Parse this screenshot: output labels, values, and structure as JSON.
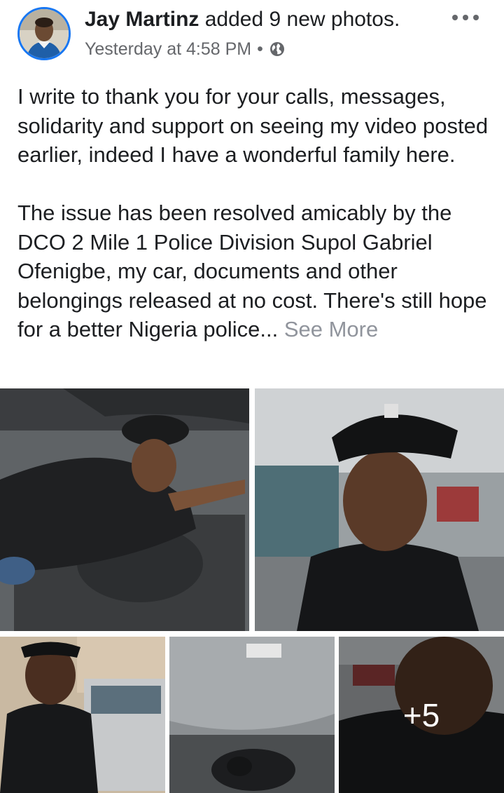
{
  "post": {
    "author_name": "Jay Martinz",
    "action": "added 9 new photos.",
    "timestamp": "Yesterday at 4:58 PM",
    "separator": "•",
    "privacy_icon": "globe-icon",
    "more_icon": "more-horizontal-icon",
    "body_paragraph_1": "I write to thank you for your calls, messages, solidarity and support on seeing my video posted earlier, indeed I have a wonderful family here.",
    "body_paragraph_2": "The issue has been resolved amicably by the DCO 2  Mile 1 Police Division Supol Gabriel Ofenigbe, my car, documents and other belongings released at no cost. There's still hope for a better Nigeria police...",
    "see_more_label": "See More"
  },
  "gallery": {
    "total_photos": 9,
    "visible_photos": 5,
    "more_count_label": "+5"
  },
  "colors": {
    "accent": "#1877f2",
    "text": "#1c1e21",
    "meta": "#65676b",
    "see_more": "#90949c"
  }
}
